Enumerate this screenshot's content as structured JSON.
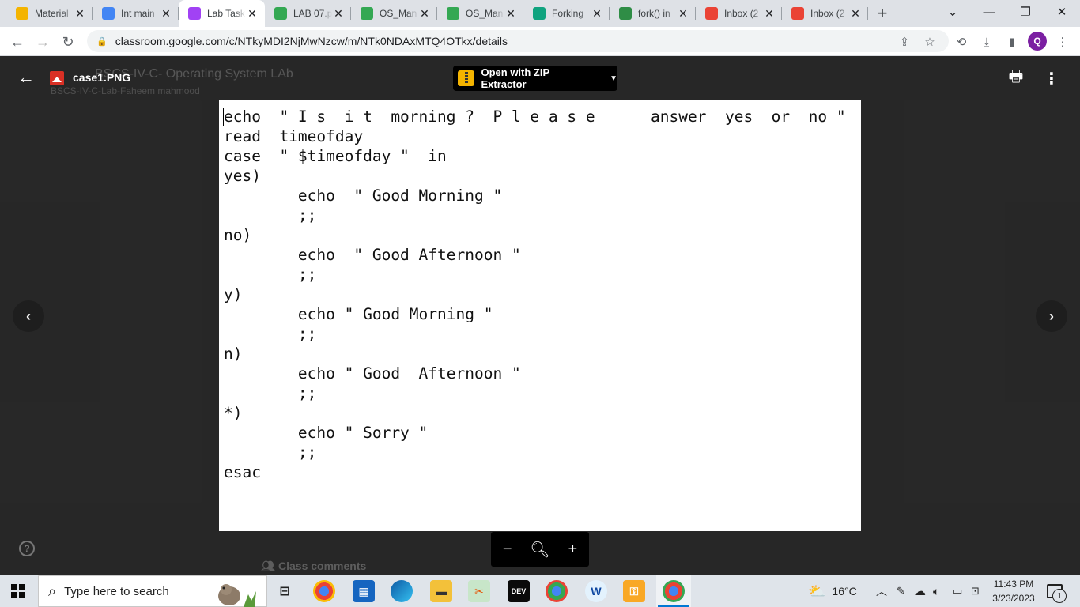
{
  "browser": {
    "tabs": [
      {
        "label": "Material",
        "icon": "classroom-icon",
        "color": "#f4b400",
        "active": false
      },
      {
        "label": "Int main",
        "icon": "google-icon",
        "color": "#4285f4",
        "active": false
      },
      {
        "label": "Lab Task",
        "icon": "classroom-assignment-icon",
        "color": "#a142f4",
        "active": true
      },
      {
        "label": "LAB 07.p",
        "icon": "drive-icon",
        "color": "#34a853",
        "active": false
      },
      {
        "label": "OS_Man",
        "icon": "drive-icon",
        "color": "#34a853",
        "active": false
      },
      {
        "label": "OS_Man",
        "icon": "drive-icon",
        "color": "#34a853",
        "active": false
      },
      {
        "label": "Forking",
        "icon": "chatgpt-icon",
        "color": "#10a37f",
        "active": false
      },
      {
        "label": "fork() in",
        "icon": "geeksforgeeks-icon",
        "color": "#2f8d46",
        "active": false
      },
      {
        "label": "Inbox (2",
        "icon": "gmail-icon",
        "color": "#ea4335",
        "active": false
      },
      {
        "label": "Inbox (2",
        "icon": "gmail-icon",
        "color": "#ea4335",
        "active": false
      }
    ],
    "new_tab_symbol": "+",
    "url": "classroom.google.com/c/NTkyMDI2NjMwNzcw/m/NTk0NDAxMTQ4OTkx/details",
    "profile_initial": "Q"
  },
  "viewer": {
    "file_name": "case1.PNG",
    "background_title": "BSCS-IV-C- Operating System LAb",
    "background_subtitle": "BSCS-IV-C-Lab-Faheem mahmood",
    "open_with_label": "Open with ZIP Extractor",
    "class_comments": "Class comments"
  },
  "code_lines": [
    "echo  \" I s  i t  morning ?  P l e a s e      answer  yes  or  no \"",
    "read  timeofday",
    "case  \" $timeofday \"  in",
    "yes)",
    "        echo  \" Good Morning \"",
    "        ;;",
    "no)",
    "        echo  \" Good Afternoon \"",
    "        ;;",
    "y)",
    "        echo \" Good Morning \"",
    "        ;;",
    "n)",
    "        echo \" Good  Afternoon \"",
    "        ;;",
    "*)",
    "        echo \" Sorry \"",
    "        ;;",
    "esac"
  ],
  "taskbar": {
    "search_placeholder": "Type here to search",
    "temperature": "16°C",
    "time": "11:43 PM",
    "date": "3/23/2023",
    "notification_count": "1"
  }
}
